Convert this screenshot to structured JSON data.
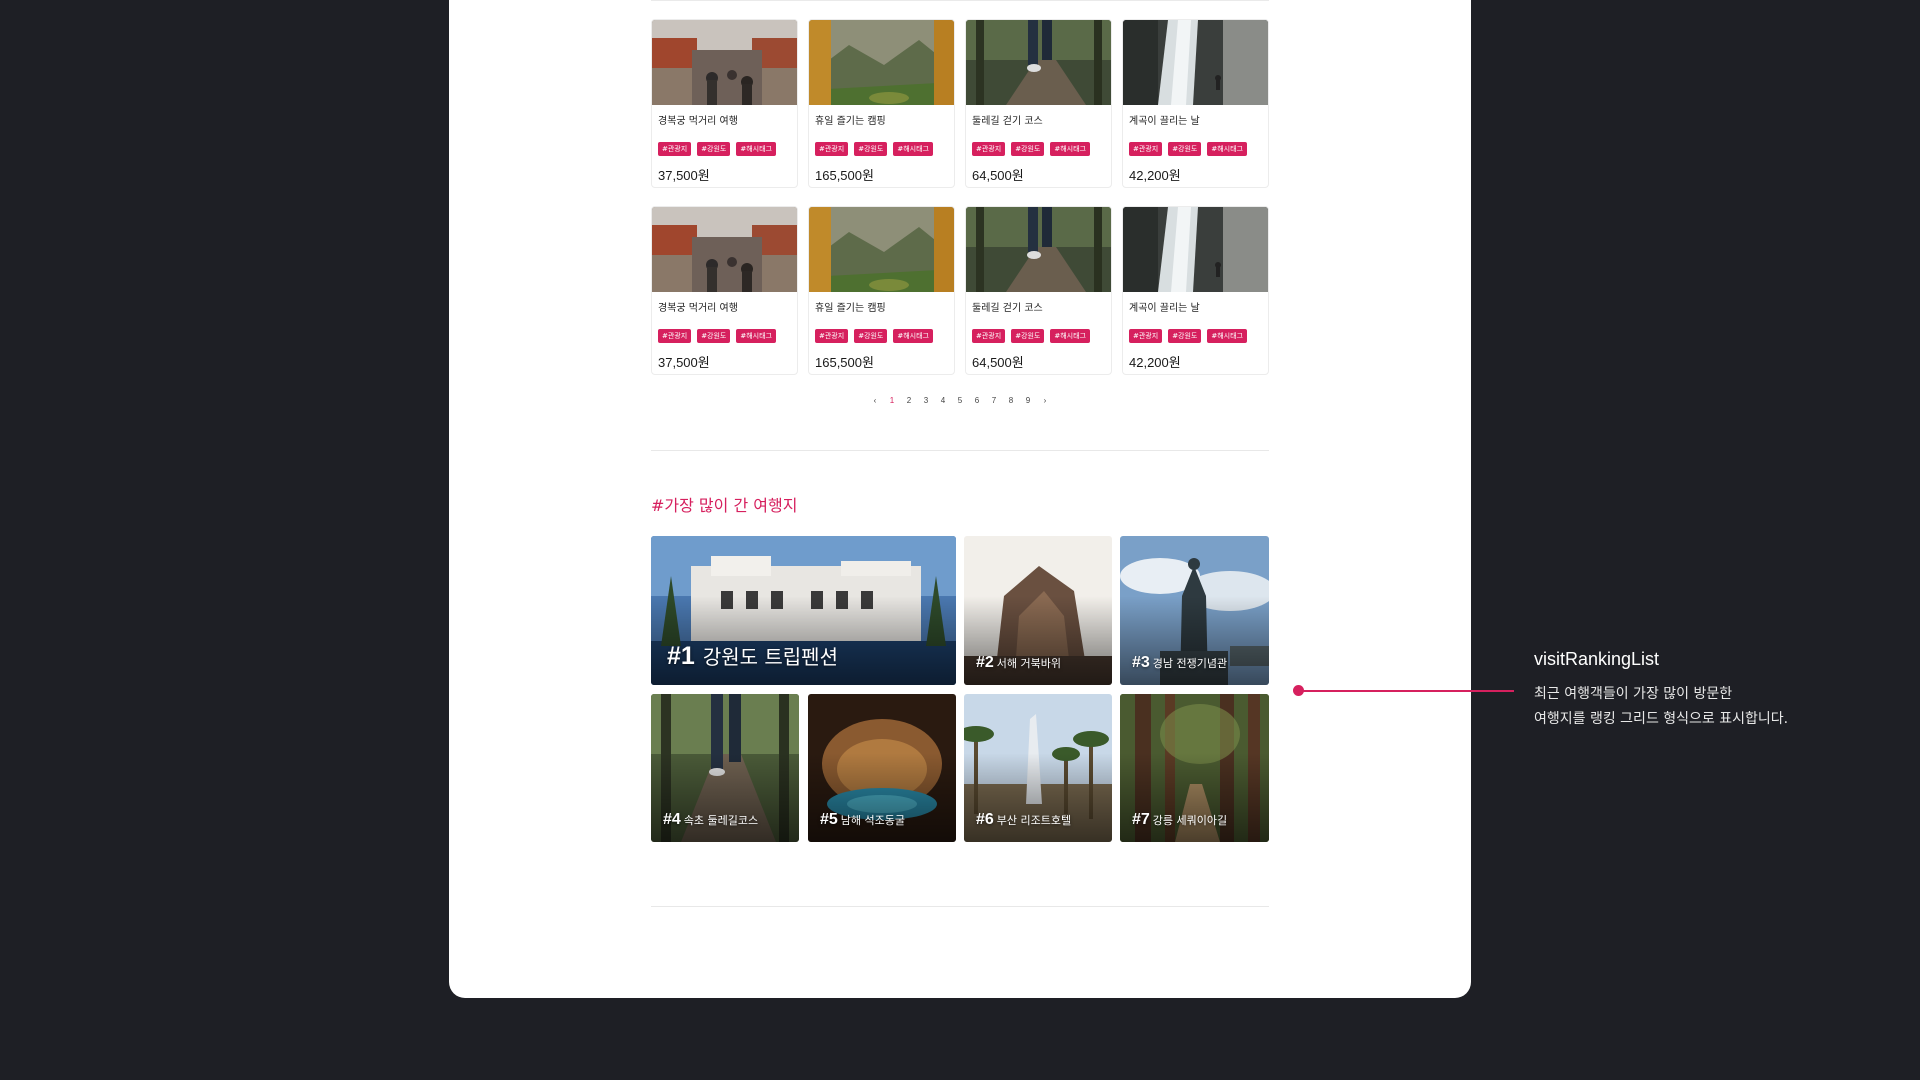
{
  "accent_color": "#d6205e",
  "background_color": "#1e1f25",
  "product_rows": [
    [
      {
        "title": "경복궁 먹거리 여행",
        "tags": [
          "#관광지",
          "#강원도",
          "#해시태그"
        ],
        "price": "37,500원",
        "image": "market-street-photo"
      },
      {
        "title": "휴일 즐기는 캠핑",
        "tags": [
          "#관광지",
          "#강원도",
          "#해시태그"
        ],
        "price": "165,500원",
        "image": "tent-mountain-photo"
      },
      {
        "title": "둘레길 걷기 코스",
        "tags": [
          "#관광지",
          "#강원도",
          "#해시태그"
        ],
        "price": "64,500원",
        "image": "forest-walk-photo"
      },
      {
        "title": "계곡이 끌리는 날",
        "tags": [
          "#관광지",
          "#강원도",
          "#해시태그"
        ],
        "price": "42,200원",
        "image": "waterfall-photo"
      }
    ],
    [
      {
        "title": "경복궁 먹거리 여행",
        "tags": [
          "#관광지",
          "#강원도",
          "#해시태그"
        ],
        "price": "37,500원",
        "image": "market-street-photo"
      },
      {
        "title": "휴일 즐기는 캠핑",
        "tags": [
          "#관광지",
          "#강원도",
          "#해시태그"
        ],
        "price": "165,500원",
        "image": "tent-mountain-photo"
      },
      {
        "title": "둘레길 걷기 코스",
        "tags": [
          "#관광지",
          "#강원도",
          "#해시태그"
        ],
        "price": "64,500원",
        "image": "forest-walk-photo"
      },
      {
        "title": "계곡이 끌리는 날",
        "tags": [
          "#관광지",
          "#강원도",
          "#해시태그"
        ],
        "price": "42,200원",
        "image": "waterfall-photo"
      }
    ]
  ],
  "pagination": {
    "prev": "‹",
    "next": "›",
    "pages": [
      "1",
      "2",
      "3",
      "4",
      "5",
      "6",
      "7",
      "8",
      "9"
    ],
    "current": "1"
  },
  "ranking": {
    "title": "#가장 많이 간 여행지",
    "items": [
      {
        "rank": "#1",
        "name": "강원도 트립펜션",
        "image": "pension-pool-photo"
      },
      {
        "rank": "#2",
        "name": "서해 거북바위",
        "image": "turtle-rock-photo"
      },
      {
        "rank": "#3",
        "name": "경남 전쟁기념관",
        "image": "memorial-statue-photo"
      },
      {
        "rank": "#4",
        "name": "속초 둘레길코스",
        "image": "forest-walk-photo"
      },
      {
        "rank": "#5",
        "name": "남해 석조동굴",
        "image": "cave-photo"
      },
      {
        "rank": "#6",
        "name": "부산 리조트호텔",
        "image": "resort-palm-photo"
      },
      {
        "rank": "#7",
        "name": "강릉 세쿼이아길",
        "image": "sequoia-path-photo"
      }
    ]
  },
  "annotation": {
    "title": "visitRankingList",
    "line1": "최근 여행객들이 가장 많이 방문한",
    "line2": "여행지를 랭킹 그리드 형식으로 표시합니다."
  }
}
